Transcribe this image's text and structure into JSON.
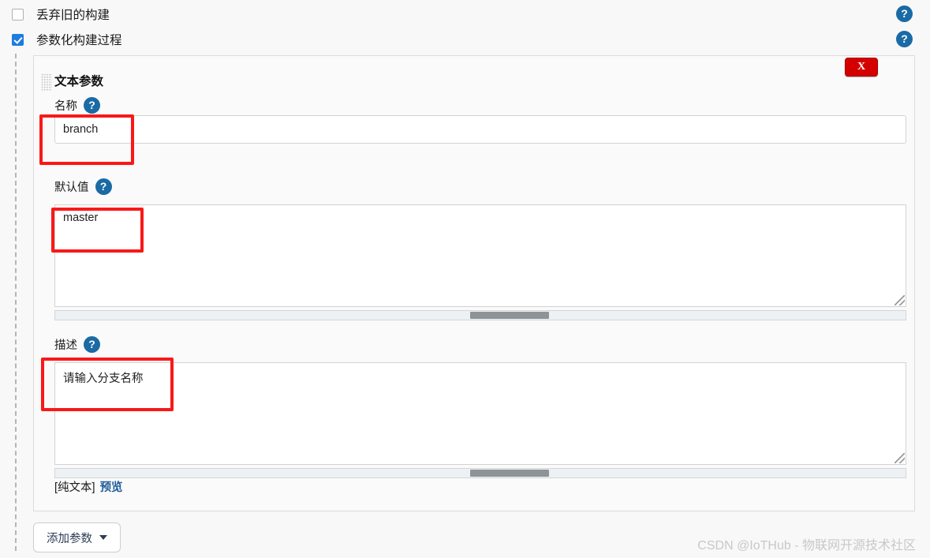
{
  "options": {
    "discard_old_builds": {
      "label": "丢弃旧的构建",
      "checked": false,
      "help_icon": "help-icon"
    },
    "parameterized_build": {
      "label": "参数化构建过程",
      "checked": true,
      "help_icon": "help-icon"
    }
  },
  "parameter_panel": {
    "title": "文本参数",
    "drag_handle_icon": "drag-handle-icon",
    "remove_button_label": "X",
    "fields": {
      "name": {
        "label": "名称",
        "value": "branch",
        "placeholder": "",
        "help_icon": "help-icon"
      },
      "default_value": {
        "label": "默认值",
        "value": "master",
        "placeholder": "",
        "help_icon": "help-icon"
      },
      "description": {
        "label": "描述",
        "value": "请输入分支名称",
        "placeholder": "",
        "help_icon": "help-icon"
      }
    },
    "markup_note": "[纯文本]",
    "preview_link": "预览"
  },
  "actions": {
    "add_parameter": "添加参数"
  },
  "watermark": "CSDN @IoTHub - 物联网开源技术社区",
  "colors": {
    "checkbox_accent": "#1e7be0",
    "help_icon": "#1a6aa5",
    "remove_button": "#d40000",
    "annotation": "#f91818",
    "link": "#1f5c99",
    "panel_bg": "#fafafa",
    "page_bg": "#f8f8f8"
  }
}
